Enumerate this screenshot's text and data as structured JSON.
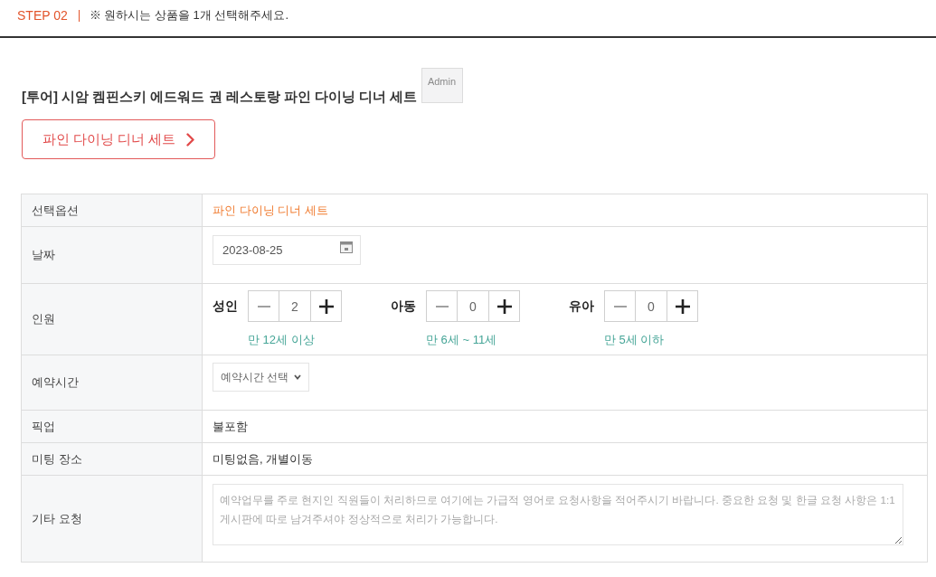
{
  "step_header": {
    "step": "STEP 02",
    "instruction": "※ 원하시는 상품을 1개 선택해주세요."
  },
  "product": {
    "title": "[투어] 시암 켐핀스키 에드워드 권 레스토랑 파인 다이닝 디너 세트",
    "admin_button": {
      "label": "Admin"
    },
    "option_button": {
      "label": "파인 다이닝 디너 세트"
    }
  },
  "form_rows": [
    {
      "kind": "accent",
      "label": "선택옵션",
      "value": "파인 다이닝 디너 세트"
    },
    {
      "kind": "date",
      "label": "날짜",
      "value": "2023-08-25"
    },
    {
      "kind": "counters",
      "label": "인원",
      "counters": [
        {
          "label": "성인",
          "value": "2",
          "hint": "만 12세 이상"
        },
        {
          "label": "아동",
          "value": "0",
          "hint": "만 6세 ~ 11세"
        },
        {
          "label": "유아",
          "value": "0",
          "hint": "만 5세 이하"
        }
      ]
    },
    {
      "kind": "select",
      "label": "예약시간",
      "value": "예약시간 선택"
    },
    {
      "kind": "text",
      "label": "픽업",
      "value": "불포함"
    },
    {
      "kind": "text",
      "label": "미팅 장소",
      "value": "미팅없음, 개별이동"
    },
    {
      "kind": "textarea",
      "label": "기타 요청",
      "placeholder": "예약업무를 주로 현지인 직원들이 처리하므로 여기에는 가급적 영어로 요청사항을 적어주시기 바랍니다. 중요한 요청 및 한글 요청 사항은 1:1 게시판에 따로 남겨주셔야 정상적으로 처리가 가능합니다."
    }
  ]
}
